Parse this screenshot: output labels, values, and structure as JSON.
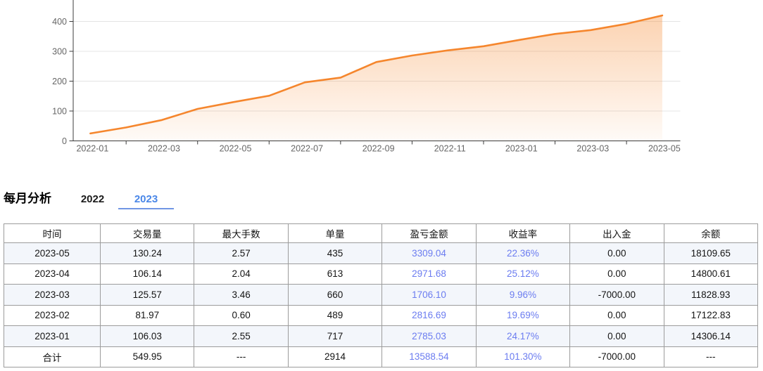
{
  "chart_data": {
    "type": "area",
    "title": "",
    "xlabel": "",
    "ylabel": "",
    "categories": [
      "2022-01",
      "2022-02",
      "2022-03",
      "2022-04",
      "2022-05",
      "2022-06",
      "2022-07",
      "2022-08",
      "2022-09",
      "2022-10",
      "2022-11",
      "2022-12",
      "2023-01",
      "2023-02",
      "2023-03",
      "2023-04",
      "2023-05"
    ],
    "values": [
      25,
      45,
      70,
      107,
      130,
      151,
      196,
      212,
      264,
      286,
      303,
      317,
      338,
      358,
      371,
      392,
      420
    ],
    "x_tick_labels": [
      "2022-01",
      "2022-03",
      "2022-05",
      "2022-07",
      "2022-09",
      "2022-11",
      "2023-01",
      "2023-03",
      "2023-05"
    ],
    "y_ticks": [
      0,
      100,
      200,
      300,
      400
    ],
    "ylim": [
      0,
      400
    ],
    "grid": true,
    "legend_position": "none",
    "line_color": "#f5862d",
    "fill_top_color": "rgba(246,138,50,0.38)",
    "fill_bottom_color": "rgba(246,138,50,0.04)",
    "grid_color": "#e4e4e4",
    "axis_color": "#3c3c3c",
    "tick_label_color": "#666666"
  },
  "section": {
    "title": "每月分析",
    "tabs": [
      {
        "label": "2022",
        "active": false
      },
      {
        "label": "2023",
        "active": true
      }
    ],
    "active_tab_color": "#4a87e8",
    "inactive_tab_color": "#1a1a1a",
    "underline_color": "#7096e4"
  },
  "table": {
    "headers": [
      "时间",
      "交易量",
      "最大手数",
      "单量",
      "盈亏金额",
      "收益率",
      "出入金",
      "余额"
    ],
    "blue_columns": [
      4,
      5
    ],
    "accent_text_color": "#6b7cf0",
    "stripe_color": "#f3f6fb",
    "border_color": "#9c9c9c",
    "rows": [
      [
        "2023-05",
        "130.24",
        "2.57",
        "435",
        "3309.04",
        "22.36%",
        "0.00",
        "18109.65"
      ],
      [
        "2023-04",
        "106.14",
        "2.04",
        "613",
        "2971.68",
        "25.12%",
        "0.00",
        "14800.61"
      ],
      [
        "2023-03",
        "125.57",
        "3.46",
        "660",
        "1706.10",
        "9.96%",
        "-7000.00",
        "11828.93"
      ],
      [
        "2023-02",
        "81.97",
        "0.60",
        "489",
        "2816.69",
        "19.69%",
        "0.00",
        "17122.83"
      ],
      [
        "2023-01",
        "106.03",
        "2.55",
        "717",
        "2785.03",
        "24.17%",
        "0.00",
        "14306.14"
      ],
      [
        "合计",
        "549.95",
        "---",
        "2914",
        "13588.54",
        "101.30%",
        "-7000.00",
        "---"
      ]
    ]
  }
}
